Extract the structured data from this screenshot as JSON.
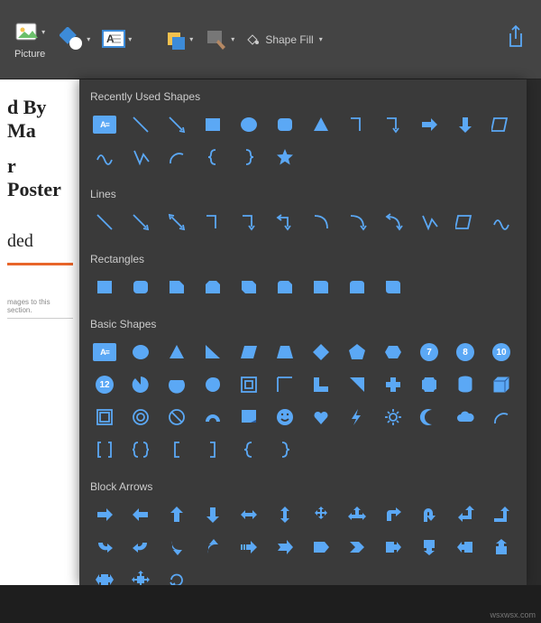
{
  "ribbon": {
    "picture_label": "Picture",
    "shape_fill_label": "Shape Fill"
  },
  "doc": {
    "title_line1": "d By Ma",
    "title_line2": "r Poster",
    "subtitle": "ded",
    "fine_print": "mages to this section."
  },
  "sections": [
    {
      "title": "Recently Used Shapes",
      "count": 18
    },
    {
      "title": "Lines",
      "count": 12
    },
    {
      "title": "Rectangles",
      "count": 9
    },
    {
      "title": "Basic Shapes",
      "count": 42
    },
    {
      "title": "Block Arrows",
      "count": 28
    }
  ],
  "watermark": "wsxwsx.com"
}
